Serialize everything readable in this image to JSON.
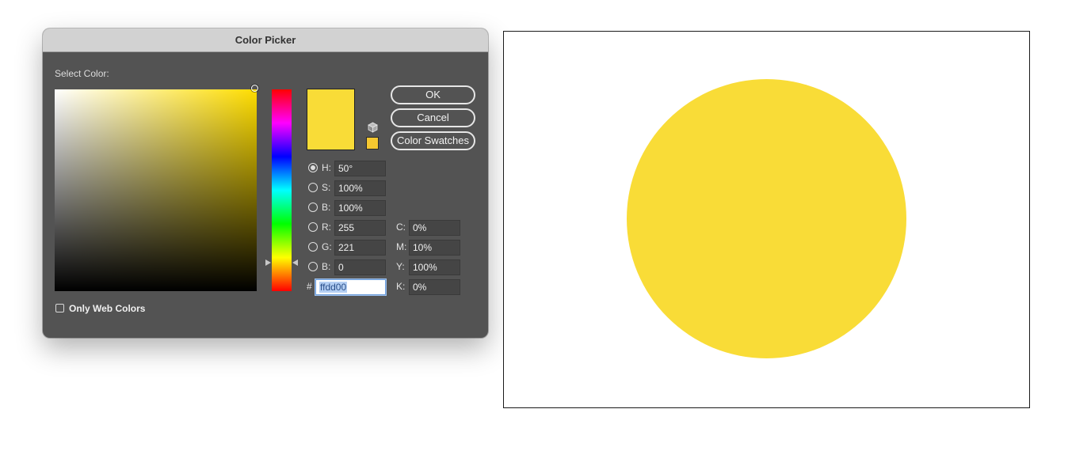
{
  "dialog": {
    "title": "Color Picker",
    "select_label": "Select Color:",
    "buttons": {
      "ok": "OK",
      "cancel": "Cancel",
      "swatches": "Color Swatches"
    },
    "fields": {
      "h": {
        "label": "H:",
        "value": "50°",
        "selected": true
      },
      "s": {
        "label": "S:",
        "value": "100%"
      },
      "b": {
        "label": "B:",
        "value": "100%"
      },
      "r": {
        "label": "R:",
        "value": "255"
      },
      "g": {
        "label": "G:",
        "value": "221"
      },
      "b2": {
        "label": "B:",
        "value": "0"
      },
      "c": {
        "label": "C:",
        "value": "0%"
      },
      "m": {
        "label": "M:",
        "value": "10%"
      },
      "y": {
        "label": "Y:",
        "value": "100%"
      },
      "k": {
        "label": "K:",
        "value": "0%"
      },
      "hex": {
        "label": "#",
        "value": "ffdd00"
      }
    },
    "only_web_colors": {
      "label": "Only Web Colors",
      "checked": false
    }
  },
  "colors": {
    "current": "#f9dc37",
    "web_safe": "#f5c730",
    "canvas_circle": "#f9dc37"
  },
  "icons": {
    "web_safe_warning": "cube-icon"
  }
}
